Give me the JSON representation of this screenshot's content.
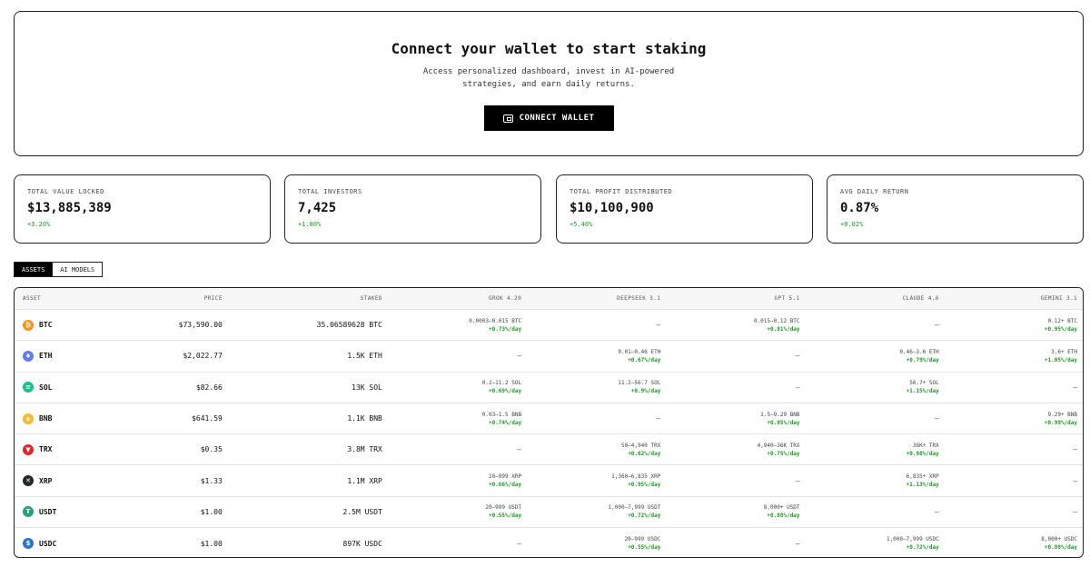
{
  "hero": {
    "title": "Connect your wallet to start staking",
    "subtitle": "Access personalized dashboard, invest in AI-powered strategies, and earn daily returns.",
    "connect_label": "CONNECT WALLET"
  },
  "stats": [
    {
      "label": "TOTAL VALUE LOCKED",
      "value": "$13,885,389",
      "change": "+3.20%"
    },
    {
      "label": "TOTAL INVESTORS",
      "value": "7,425",
      "change": "+1.80%"
    },
    {
      "label": "TOTAL PROFIT DISTRIBUTED",
      "value": "$10,100,900",
      "change": "+5.40%"
    },
    {
      "label": "AVG DAILY RETURN",
      "value": "0.87%",
      "change": "+0.02%"
    }
  ],
  "tabs": [
    "ASSETS",
    "AI MODELS"
  ],
  "table": {
    "headers": [
      "ASSET",
      "PRICE",
      "STAKED",
      "GROK 4.20",
      "DEEPSEEK 3.1",
      "GPT 5.1",
      "CLAUDE 4.6",
      "GEMINI 3.1"
    ],
    "rows": [
      {
        "asset": "BTC",
        "color": "#f7931a",
        "glyph": "₿",
        "price": "$73,590.00",
        "staked": "35.06589628 BTC",
        "models": [
          {
            "range": "0.0003–0.015 BTC",
            "rate": "+0.73%/day"
          },
          {
            "dash": "—"
          },
          {
            "range": "0.015–0.12 BTC",
            "rate": "+0.81%/day"
          },
          {
            "dash": "—"
          },
          {
            "range": "0.12+ BTC",
            "rate": "+0.95%/day"
          }
        ]
      },
      {
        "asset": "ETH",
        "color": "#627eea",
        "glyph": "♦",
        "price": "$2,022.77",
        "staked": "1.5K ETH",
        "models": [
          {
            "dash": "—"
          },
          {
            "range": "0.01–0.46 ETH",
            "rate": "+0.67%/day"
          },
          {
            "dash": "—"
          },
          {
            "range": "0.46–3.6 ETH",
            "rate": "+0.79%/day"
          },
          {
            "range": "3.6+ ETH",
            "rate": "+1.05%/day"
          }
        ]
      },
      {
        "asset": "SOL",
        "color": "#14c48c",
        "glyph": "≡",
        "price": "$82.66",
        "staked": "13K SOL",
        "models": [
          {
            "range": "0.2–11.2 SOL",
            "rate": "+0.69%/day"
          },
          {
            "range": "11.2–56.7 SOL",
            "rate": "+0.9%/day"
          },
          {
            "dash": "—"
          },
          {
            "range": "56.7+ SOL",
            "rate": "+1.15%/day"
          },
          {
            "dash": "—"
          }
        ]
      },
      {
        "asset": "BNB",
        "color": "#f3ba2f",
        "glyph": "◈",
        "price": "$641.59",
        "staked": "1.1K BNB",
        "models": [
          {
            "range": "0.03–1.5 BNB",
            "rate": "+0.74%/day"
          },
          {
            "dash": "—"
          },
          {
            "range": "1.5–9.29 BNB",
            "rate": "+0.85%/day"
          },
          {
            "dash": "—"
          },
          {
            "range": "9.29+ BNB",
            "rate": "+0.99%/day"
          }
        ]
      },
      {
        "asset": "TRX",
        "color": "#e0252f",
        "glyph": "▼",
        "price": "$0.35",
        "staked": "3.8M TRX",
        "models": [
          {
            "dash": "—"
          },
          {
            "range": "50–4,940 TRX",
            "rate": "+0.62%/day"
          },
          {
            "range": "4,940–36K TRX",
            "rate": "+0.75%/day"
          },
          {
            "range": "36K+ TRX",
            "rate": "+0.98%/day"
          },
          {
            "dash": "—"
          }
        ]
      },
      {
        "asset": "XRP",
        "color": "#23292f",
        "glyph": "✕",
        "price": "$1.33",
        "staked": "1.1M XRP",
        "models": [
          {
            "range": "20–999 XRP",
            "rate": "+0.66%/day"
          },
          {
            "range": "1,360–6,835 XRP",
            "rate": "+0.95%/day"
          },
          {
            "dash": "—"
          },
          {
            "range": "6,835+ XRP",
            "rate": "+1.13%/day"
          },
          {
            "dash": "—"
          }
        ]
      },
      {
        "asset": "USDT",
        "color": "#26a17b",
        "glyph": "T",
        "price": "$1.00",
        "staked": "2.5M USDT",
        "models": [
          {
            "range": "20–999 USDT",
            "rate": "+0.55%/day"
          },
          {
            "range": "1,000–7,999 USDT",
            "rate": "+0.72%/day"
          },
          {
            "range": "8,000+ USDT",
            "rate": "+0.88%/day"
          },
          {
            "dash": "—"
          },
          {
            "dash": "—"
          }
        ]
      },
      {
        "asset": "USDC",
        "color": "#2775ca",
        "glyph": "$",
        "price": "$1.00",
        "staked": "897K USDC",
        "models": [
          {
            "dash": "—"
          },
          {
            "range": "20–999 USDC",
            "rate": "+0.55%/day"
          },
          {
            "dash": "—"
          },
          {
            "range": "1,000–7,999 USDC",
            "rate": "+0.72%/day"
          },
          {
            "range": "8,000+ USDC",
            "rate": "+0.88%/day"
          }
        ]
      }
    ]
  }
}
